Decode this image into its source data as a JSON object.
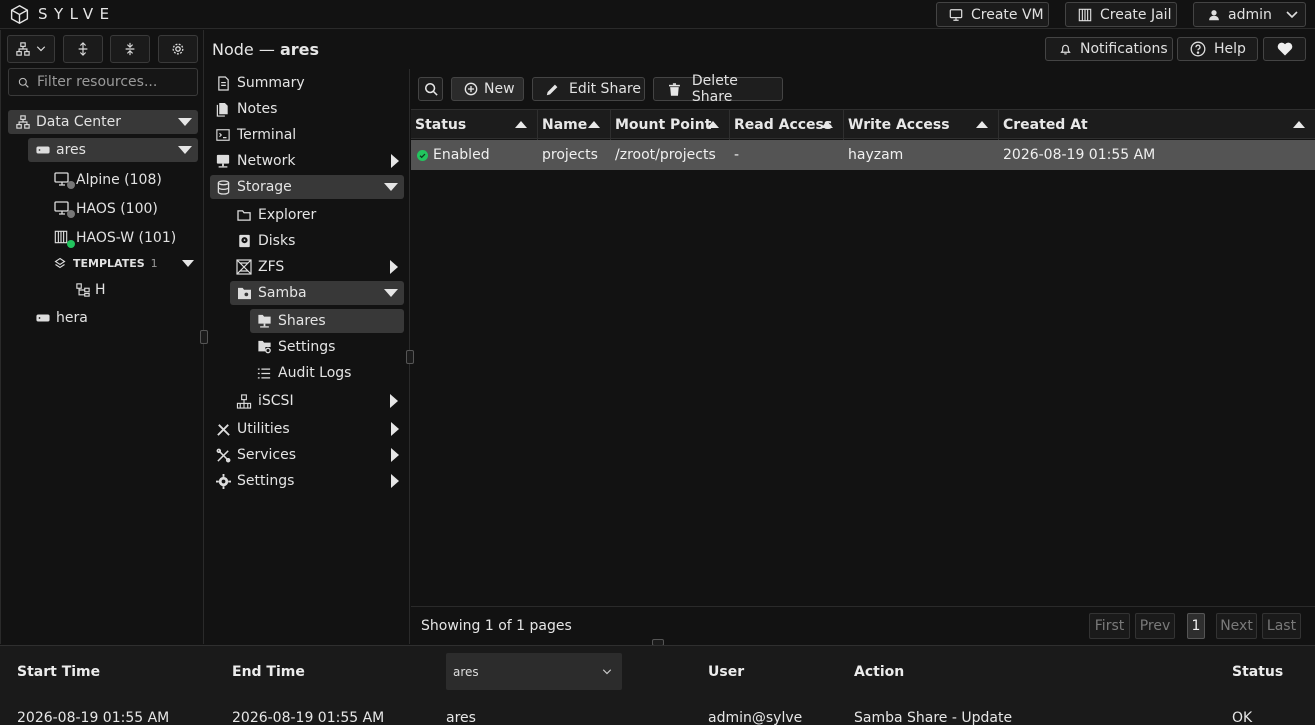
{
  "app": {
    "name": "SYLVE"
  },
  "topbar": {
    "create_vm": "Create VM",
    "create_jail": "Create Jail",
    "user": "admin"
  },
  "leftpanel": {
    "filter_placeholder": "Filter resources...",
    "tree": {
      "datacenter": "Data Center",
      "node_ares": "ares",
      "vm1": "Alpine (108)",
      "vm2": "HAOS (100)",
      "jail1": "HAOS-W (101)",
      "templates_label": "TEMPLATES",
      "templates_count": "1",
      "template1": "H",
      "node_hera": "hera"
    }
  },
  "header": {
    "title_prefix": "Node —",
    "title_node": "ares",
    "notifications": "Notifications",
    "help": "Help"
  },
  "nav": {
    "summary": "Summary",
    "notes": "Notes",
    "terminal": "Terminal",
    "network": "Network",
    "storage": "Storage",
    "explorer": "Explorer",
    "disks": "Disks",
    "zfs": "ZFS",
    "samba": "Samba",
    "shares": "Shares",
    "settings_sub": "Settings",
    "audit_logs": "Audit Logs",
    "iscsi": "iSCSI",
    "utilities": "Utilities",
    "services": "Services",
    "settings": "Settings"
  },
  "toolbar": {
    "new": "New",
    "edit": "Edit Share",
    "delete": "Delete Share"
  },
  "table": {
    "columns": [
      "Status",
      "Name",
      "Mount Point",
      "Read Access",
      "Write Access",
      "Created At"
    ],
    "rows": [
      {
        "status": "Enabled",
        "name": "projects",
        "mount": "/zroot/projects",
        "read": "-",
        "write": "hayzam",
        "created": "2026-08-19 01:55 AM"
      }
    ],
    "status_color": "#22c55e",
    "footer": "Showing 1 of 1 pages",
    "pagination": {
      "first": "First",
      "prev": "Prev",
      "page": "1",
      "next": "Next",
      "last": "Last"
    }
  },
  "audit": {
    "columns": {
      "start": "Start Time",
      "end": "End Time",
      "user": "User",
      "action": "Action",
      "status": "Status"
    },
    "node_filter": "ares",
    "row": {
      "start": "2026-08-19 01:55 AM",
      "end": "2026-08-19 01:55 AM",
      "node": "ares",
      "user": "admin@sylve",
      "action": "Samba Share - Update",
      "status": "OK"
    }
  },
  "icons": {
    "logo": "cube-icon",
    "monitor": "monitor-icon",
    "jail": "jail-icon",
    "user": "user-icon",
    "bell": "bell-icon",
    "help": "help-icon",
    "heart": "heart-icon",
    "search": "search-icon",
    "plus": "plus-circle-icon",
    "pencil": "pencil-icon",
    "trash": "trash-icon"
  }
}
